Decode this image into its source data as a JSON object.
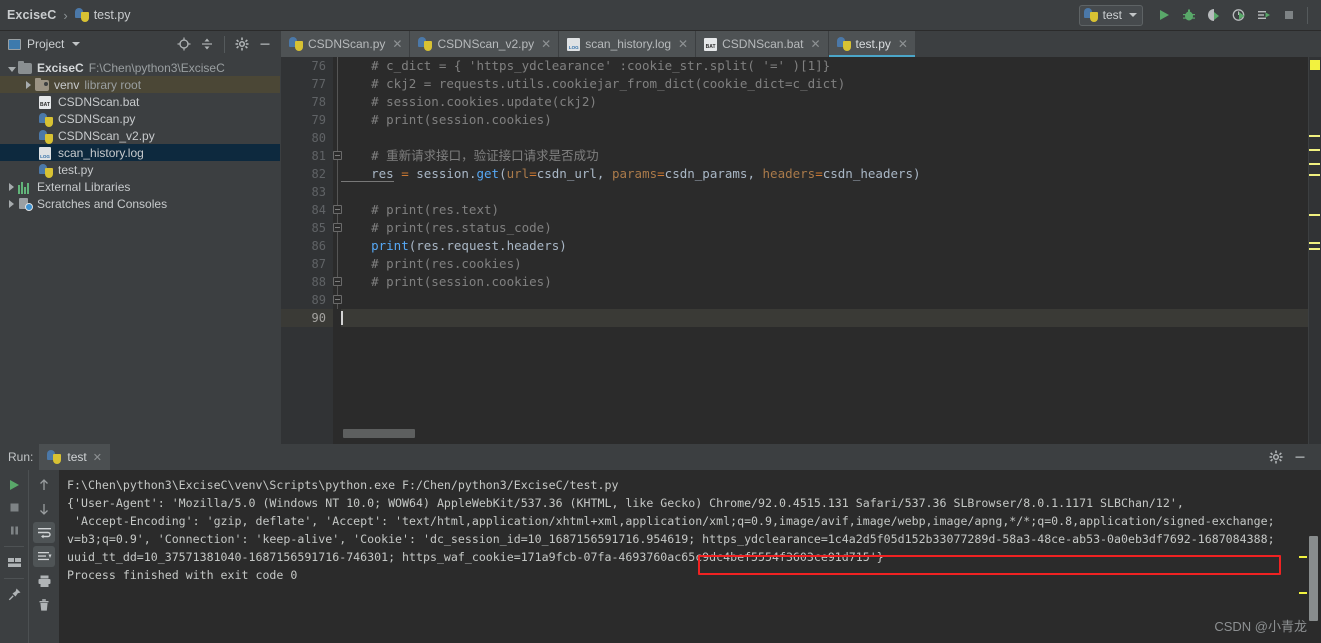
{
  "titlebar": {
    "breadcrumb_project": "ExciseC",
    "breadcrumb_sep": "›",
    "breadcrumb_file": "test.py",
    "run_config": "test",
    "icons": [
      "run-icon",
      "debug-icon",
      "run-coverage-icon",
      "profile-icon",
      "run-with-console-icon",
      "stop-icon"
    ]
  },
  "project_panel": {
    "title": "Project",
    "tools": [
      "locate-icon",
      "collapse-all-icon",
      "settings-icon",
      "hide-icon"
    ],
    "tree": [
      {
        "label": "ExciseC",
        "detail": "F:\\Chen\\python3\\ExciseC",
        "icon": "folder-icon",
        "indent": 0,
        "arrow": "down",
        "bold": true,
        "state": "normal"
      },
      {
        "label": "venv",
        "detail": "library root",
        "icon": "folder-venv-icon",
        "indent": 1,
        "arrow": "right",
        "bold": false,
        "state": "venv"
      },
      {
        "label": "CSDNScan.bat",
        "detail": "",
        "icon": "bat-file-icon",
        "indent": 2,
        "arrow": "none",
        "bold": false,
        "state": "normal"
      },
      {
        "label": "CSDNScan.py",
        "detail": "",
        "icon": "python-file-icon",
        "indent": 2,
        "arrow": "none",
        "bold": false,
        "state": "normal"
      },
      {
        "label": "CSDNScan_v2.py",
        "detail": "",
        "icon": "python-file-icon",
        "indent": 2,
        "arrow": "none",
        "bold": false,
        "state": "normal"
      },
      {
        "label": "scan_history.log",
        "detail": "",
        "icon": "log-file-icon",
        "indent": 2,
        "arrow": "none",
        "bold": false,
        "state": "selected"
      },
      {
        "label": "test.py",
        "detail": "",
        "icon": "python-file-icon",
        "indent": 2,
        "arrow": "none",
        "bold": false,
        "state": "normal"
      },
      {
        "label": "External Libraries",
        "detail": "",
        "icon": "libraries-icon",
        "indent": 0,
        "arrow": "right",
        "bold": false,
        "state": "normal"
      },
      {
        "label": "Scratches and Consoles",
        "detail": "",
        "icon": "scratches-icon",
        "indent": 0,
        "arrow": "right",
        "bold": false,
        "state": "normal"
      }
    ]
  },
  "editor": {
    "tabs": [
      {
        "label": "CSDNScan.py",
        "icon": "python-file-icon",
        "active": false
      },
      {
        "label": "CSDNScan_v2.py",
        "icon": "python-file-icon",
        "active": false
      },
      {
        "label": "scan_history.log",
        "icon": "log-file-icon",
        "active": false
      },
      {
        "label": "CSDNScan.bat",
        "icon": "bat-file-icon",
        "active": false
      },
      {
        "label": "test.py",
        "icon": "python-file-icon",
        "active": true
      }
    ],
    "first_line_number": 76,
    "cursor_line": 90,
    "lines": [
      {
        "n": 76,
        "text": "    # c_dict = { 'https_ydclearance' :cookie_str.split( '=' )[1]}"
      },
      {
        "n": 77,
        "text": "    # ckj2 = requests.utils.cookiejar_from_dict(cookie_dict=c_dict)"
      },
      {
        "n": 78,
        "text": "    # session.cookies.update(ckj2)"
      },
      {
        "n": 79,
        "text": "    # print(session.cookies)"
      },
      {
        "n": 80,
        "text": ""
      },
      {
        "n": 81,
        "text": "    # 重新请求接口，验证接口请求是否成功"
      },
      {
        "n": 82,
        "text": "    res = session.get(url=csdn_url, params=csdn_params, headers=csdn_headers)"
      },
      {
        "n": 83,
        "text": ""
      },
      {
        "n": 84,
        "text": "    # print(res.text)"
      },
      {
        "n": 85,
        "text": "    # print(res.status_code)"
      },
      {
        "n": 86,
        "text": "    print(res.request.headers)"
      },
      {
        "n": 87,
        "text": "    # print(res.cookies)"
      },
      {
        "n": 88,
        "text": "    # print(session.cookies)"
      },
      {
        "n": 89,
        "text": ""
      },
      {
        "n": 90,
        "text": ""
      }
    ]
  },
  "run_panel": {
    "label": "Run:",
    "tab_label": "test",
    "tab_icon": "python-file-icon",
    "tools_left": [
      "rerun-icon",
      "stop-icon",
      "pause-icon",
      "layout-icon",
      "pin-icon"
    ],
    "tools_right": [
      "up-icon",
      "down-icon",
      "soft-wrap-icon",
      "scroll-to-end-icon",
      "print-icon",
      "trash-icon"
    ],
    "header_tools": [
      "settings-icon",
      "hide-icon"
    ],
    "console_lines": [
      "F:\\Chen\\python3\\ExciseC\\venv\\Scripts\\python.exe F:/Chen/python3/ExciseC/test.py",
      "{'User-Agent': 'Mozilla/5.0 (Windows NT 10.0; WOW64) AppleWebKit/537.36 (KHTML, like Gecko) Chrome/92.0.4515.131 Safari/537.36 SLBrowser/8.0.1.1171 SLBChan/12',",
      " 'Accept-Encoding': 'gzip, deflate', 'Accept': 'text/html,application/xhtml+xml,application/xml;q=0.9,image/avif,image/webp,image/apng,*/*;q=0.8,application/signed-exchange;",
      "v=b3;q=0.9', 'Connection': 'keep-alive', 'Cookie': 'dc_session_id=10_1687156591716.954619; https_ydclearance=1c4a2d5f05d152b33077289d-58a3-48ce-ab53-0a0eb3df7692-1687084388;",
      "uuid_tt_dd=10_37571381040-1687156591716-746301; https_waf_cookie=171a9fcb-07fa-4693760ac65c9dc4bef5554f3603ce91d715'}",
      "",
      "Process finished with exit code 0"
    ],
    "highlight_text": "https_ydclearance=1c4a2d5f05d152b33077289d-58a3-48ce-ab53-0a0eb3df7692-1687084388;",
    "highlight_color": "#f02222"
  },
  "watermark": "CSDN @小青龙",
  "colors": {
    "bg_chrome": "#3c3f41",
    "bg_editor": "#2b2b2b",
    "accent_tab": "#4ba6c9",
    "selection": "#0d293e",
    "warning_marker": "#f2f23f"
  }
}
